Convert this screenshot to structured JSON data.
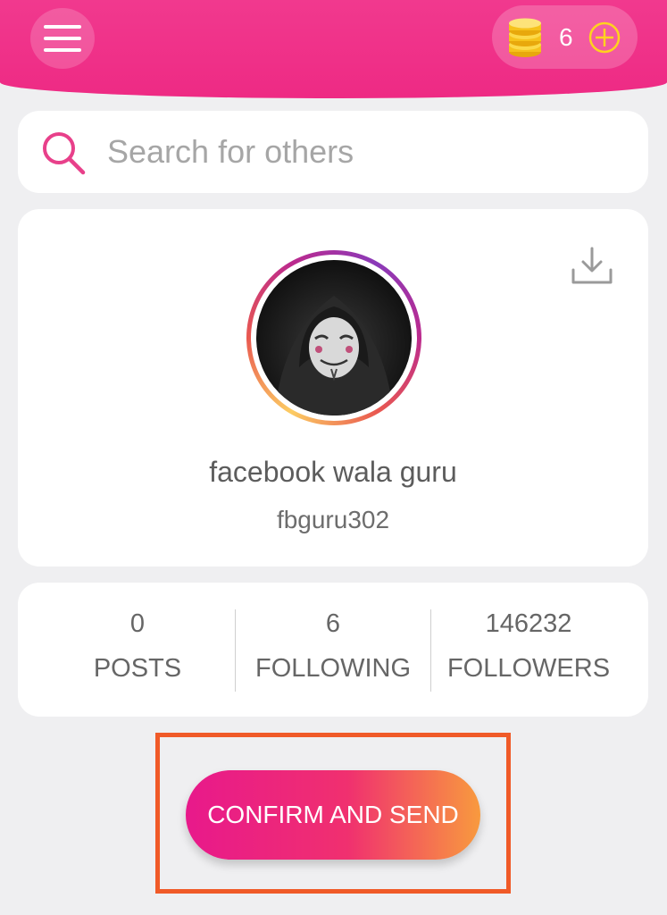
{
  "header": {
    "coin_count": "6"
  },
  "search": {
    "placeholder": "Search for others"
  },
  "profile": {
    "name": "facebook wala guru",
    "username": "fbguru302"
  },
  "stats": [
    {
      "value": "0",
      "label": "POSTS"
    },
    {
      "value": "6",
      "label": "FOLLOWING"
    },
    {
      "value": "146232",
      "label": "FOLLOWERS"
    }
  ],
  "actions": {
    "confirm_label": "CONFIRM AND SEND"
  },
  "colors": {
    "brand_pink": "#ee2a84",
    "highlight": "#f05a28",
    "button_end": "#f89a3e"
  },
  "icons": {
    "menu": "hamburger-menu-icon",
    "coins": "coins-icon",
    "add": "plus-circle-icon",
    "search": "search-icon",
    "download": "download-icon"
  }
}
